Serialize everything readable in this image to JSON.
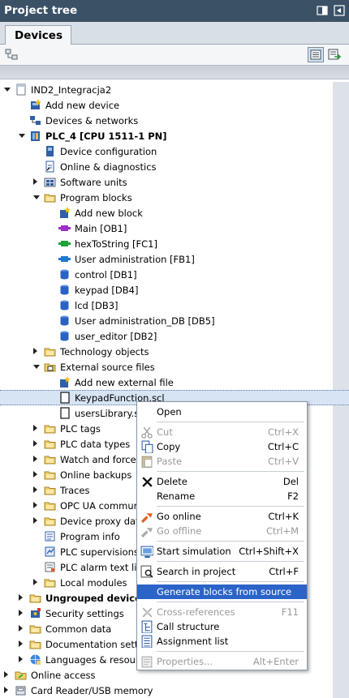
{
  "window": {
    "title": "Project tree"
  },
  "tabs": [
    {
      "label": "Devices"
    }
  ],
  "tree": [
    {
      "label": "IND2_Integracja2",
      "level": 0,
      "expander": "open",
      "icon": "project-icon",
      "bold": false
    },
    {
      "label": "Add new device",
      "level": 1,
      "expander": "none",
      "icon": "add-device-icon",
      "bold": false
    },
    {
      "label": "Devices & networks",
      "level": 1,
      "expander": "none",
      "icon": "network-icon",
      "bold": false
    },
    {
      "label": "PLC_4 [CPU 1511-1 PN]",
      "level": 1,
      "expander": "open",
      "icon": "plc-icon",
      "bold": true
    },
    {
      "label": "Device configuration",
      "level": 2,
      "expander": "none",
      "icon": "device-config-icon",
      "bold": false
    },
    {
      "label": "Online & diagnostics",
      "level": 2,
      "expander": "none",
      "icon": "diagnostics-icon",
      "bold": false
    },
    {
      "label": "Software units",
      "level": 2,
      "expander": "closed",
      "icon": "software-units-icon",
      "bold": false
    },
    {
      "label": "Program blocks",
      "level": 2,
      "expander": "open",
      "icon": "folder-icon",
      "bold": false
    },
    {
      "label": "Add new block",
      "level": 3,
      "expander": "none",
      "icon": "add-block-icon",
      "bold": false
    },
    {
      "label": "Main [OB1]",
      "level": 3,
      "expander": "none",
      "icon": "ob-icon",
      "bold": false
    },
    {
      "label": "hexToString [FC1]",
      "level": 3,
      "expander": "none",
      "icon": "fc-icon",
      "bold": false
    },
    {
      "label": "User administration [FB1]",
      "level": 3,
      "expander": "none",
      "icon": "fb-icon",
      "bold": false
    },
    {
      "label": "control [DB1]",
      "level": 3,
      "expander": "none",
      "icon": "db-icon",
      "bold": false
    },
    {
      "label": "keypad [DB4]",
      "level": 3,
      "expander": "none",
      "icon": "db-icon",
      "bold": false
    },
    {
      "label": "lcd [DB3]",
      "level": 3,
      "expander": "none",
      "icon": "db-icon",
      "bold": false
    },
    {
      "label": "User administration_DB [DB5]",
      "level": 3,
      "expander": "none",
      "icon": "db-icon",
      "bold": false
    },
    {
      "label": "user_editor [DB2]",
      "level": 3,
      "expander": "none",
      "icon": "db-icon",
      "bold": false
    },
    {
      "label": "Technology objects",
      "level": 2,
      "expander": "closed",
      "icon": "folder-icon",
      "bold": false
    },
    {
      "label": "External source files",
      "level": 2,
      "expander": "open",
      "icon": "external-files-icon",
      "bold": false
    },
    {
      "label": "Add new external file",
      "level": 3,
      "expander": "none",
      "icon": "add-block-icon",
      "bold": false
    },
    {
      "label": "KeypadFunction.scl",
      "level": 3,
      "expander": "none",
      "icon": "file-icon",
      "bold": false,
      "selected": true
    },
    {
      "label": "usersLibrary.s",
      "level": 3,
      "expander": "none",
      "icon": "file-icon",
      "bold": false
    },
    {
      "label": "PLC tags",
      "level": 2,
      "expander": "closed",
      "icon": "folder-icon",
      "bold": false
    },
    {
      "label": "PLC data types",
      "level": 2,
      "expander": "closed",
      "icon": "folder-icon",
      "bold": false
    },
    {
      "label": "Watch and force t",
      "level": 2,
      "expander": "closed",
      "icon": "folder-icon",
      "bold": false
    },
    {
      "label": "Online backups",
      "level": 2,
      "expander": "closed",
      "icon": "folder-icon",
      "bold": false
    },
    {
      "label": "Traces",
      "level": 2,
      "expander": "closed",
      "icon": "folder-icon",
      "bold": false
    },
    {
      "label": "OPC UA commun",
      "level": 2,
      "expander": "closed",
      "icon": "folder-icon",
      "bold": false
    },
    {
      "label": "Device proxy data",
      "level": 2,
      "expander": "closed",
      "icon": "folder-icon",
      "bold": false
    },
    {
      "label": "Program info",
      "level": 2,
      "expander": "none",
      "icon": "program-info-icon",
      "bold": false
    },
    {
      "label": "PLC supervisions",
      "level": 2,
      "expander": "none",
      "icon": "supervision-icon",
      "bold": false
    },
    {
      "label": "PLC alarm text lis",
      "level": 2,
      "expander": "none",
      "icon": "alarm-text-icon",
      "bold": false
    },
    {
      "label": "Local modules",
      "level": 2,
      "expander": "closed",
      "icon": "folder-icon",
      "bold": false
    },
    {
      "label": "Ungrouped devices",
      "level": 1,
      "expander": "closed",
      "icon": "folder-icon",
      "bold": true
    },
    {
      "label": "Security settings",
      "level": 1,
      "expander": "closed",
      "icon": "security-icon",
      "bold": false
    },
    {
      "label": "Common data",
      "level": 1,
      "expander": "closed",
      "icon": "folder-icon",
      "bold": false
    },
    {
      "label": "Documentation setti",
      "level": 1,
      "expander": "closed",
      "icon": "folder-icon",
      "bold": false
    },
    {
      "label": "Languages & resour",
      "level": 1,
      "expander": "closed",
      "icon": "languages-icon",
      "bold": false
    },
    {
      "label": "Online access",
      "level": 0,
      "expander": "closed",
      "icon": "online-access-icon",
      "bold": false
    },
    {
      "label": "Card Reader/USB memory",
      "level": 0,
      "expander": "closed",
      "icon": "card-reader-icon",
      "bold": false
    }
  ],
  "context_menu": {
    "items": [
      {
        "type": "item",
        "label": "Open",
        "shortcut": "",
        "icon": "",
        "disabled": false
      },
      {
        "type": "sep"
      },
      {
        "type": "item",
        "label": "Cut",
        "shortcut": "Ctrl+X",
        "icon": "cut-icon",
        "disabled": true
      },
      {
        "type": "item",
        "label": "Copy",
        "shortcut": "Ctrl+C",
        "icon": "copy-icon",
        "disabled": false
      },
      {
        "type": "item",
        "label": "Paste",
        "shortcut": "Ctrl+V",
        "icon": "paste-icon",
        "disabled": true
      },
      {
        "type": "sep"
      },
      {
        "type": "item",
        "label": "Delete",
        "shortcut": "Del",
        "icon": "delete-icon",
        "disabled": false
      },
      {
        "type": "item",
        "label": "Rename",
        "shortcut": "F2",
        "icon": "",
        "disabled": false
      },
      {
        "type": "sep"
      },
      {
        "type": "item",
        "label": "Go online",
        "shortcut": "Ctrl+K",
        "icon": "go-online-icon",
        "disabled": false
      },
      {
        "type": "item",
        "label": "Go offline",
        "shortcut": "Ctrl+M",
        "icon": "go-offline-icon",
        "disabled": true
      },
      {
        "type": "sep"
      },
      {
        "type": "item",
        "label": "Start simulation",
        "shortcut": "Ctrl+Shift+X",
        "icon": "simulation-icon",
        "disabled": false
      },
      {
        "type": "sep"
      },
      {
        "type": "item",
        "label": "Search in project",
        "shortcut": "Ctrl+F",
        "icon": "search-icon",
        "disabled": false
      },
      {
        "type": "sep"
      },
      {
        "type": "item",
        "label": "Generate blocks from source",
        "shortcut": "",
        "icon": "",
        "disabled": false,
        "highlighted": true
      },
      {
        "type": "sep"
      },
      {
        "type": "item",
        "label": "Cross-references",
        "shortcut": "F11",
        "icon": "cross-references-icon",
        "disabled": true
      },
      {
        "type": "item",
        "label": "Call structure",
        "shortcut": "",
        "icon": "call-structure-icon",
        "disabled": false
      },
      {
        "type": "item",
        "label": "Assignment list",
        "shortcut": "",
        "icon": "assignment-list-icon",
        "disabled": false
      },
      {
        "type": "sep"
      },
      {
        "type": "item",
        "label": "Properties...",
        "shortcut": "Alt+Enter",
        "icon": "properties-icon",
        "disabled": true
      }
    ]
  },
  "colors": {
    "titlebar": "#3b5166",
    "selection": "#d7e4f3",
    "menu_highlight": "#2b63c8"
  }
}
